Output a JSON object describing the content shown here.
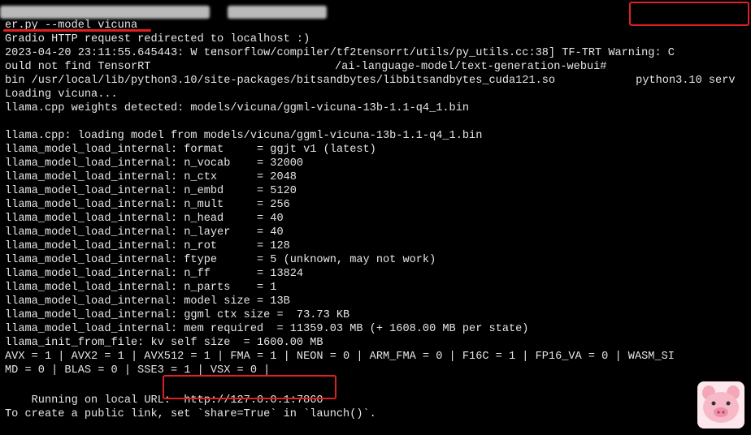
{
  "terminal": {
    "prompt_suffix": ":",
    "prompt_path": "/ai-language-model/text-generation-webui#",
    "command_part1": " python3.10 serv",
    "lines": [
      "er.py --model vicuna",
      "Gradio HTTP request redirected to localhost :)",
      "2023-04-20 23:11:55.645443: W tensorflow/compiler/tf2tensorrt/utils/py_utils.cc:38] TF-TRT Warning: C",
      "ould not find TensorRT",
      "bin /usr/local/lib/python3.10/site-packages/bitsandbytes/libbitsandbytes_cuda121.so",
      "Loading vicuna...",
      "llama.cpp weights detected: models/vicuna/ggml-vicuna-13b-1.1-q4_1.bin",
      "",
      "llama.cpp: loading model from models/vicuna/ggml-vicuna-13b-1.1-q4_1.bin",
      "llama_model_load_internal: format     = ggjt v1 (latest)",
      "llama_model_load_internal: n_vocab    = 32000",
      "llama_model_load_internal: n_ctx      = 2048",
      "llama_model_load_internal: n_embd     = 5120",
      "llama_model_load_internal: n_mult     = 256",
      "llama_model_load_internal: n_head     = 40",
      "llama_model_load_internal: n_layer    = 40",
      "llama_model_load_internal: n_rot      = 128",
      "llama_model_load_internal: ftype      = 5 (unknown, may not work)",
      "llama_model_load_internal: n_ff       = 13824",
      "llama_model_load_internal: n_parts    = 1",
      "llama_model_load_internal: model size = 13B",
      "llama_model_load_internal: ggml ctx size =  73.73 KB",
      "llama_model_load_internal: mem required  = 11359.03 MB (+ 1608.00 MB per state)",
      "llama_init_from_file: kv self size  = 1600.00 MB",
      "AVX = 1 | AVX2 = 1 | AVX512 = 1 | FMA = 1 | NEON = 0 | ARM_FMA = 0 | F16C = 1 | FP16_VA = 0 | WASM_SI",
      "MD = 0 | BLAS = 0 | SSE3 = 1 | VSX = 0 |"
    ],
    "running_label": "Running on local URL:  ",
    "local_url": "http://127.0.0.1:7860",
    "public_link_hint": "To create a public link, set `share=True` in `launch()`."
  },
  "colors": {
    "background": "#000000",
    "text": "#e6e6e6",
    "highlight": "#e02020"
  },
  "mascot": {
    "icon": "pig-face-icon"
  }
}
